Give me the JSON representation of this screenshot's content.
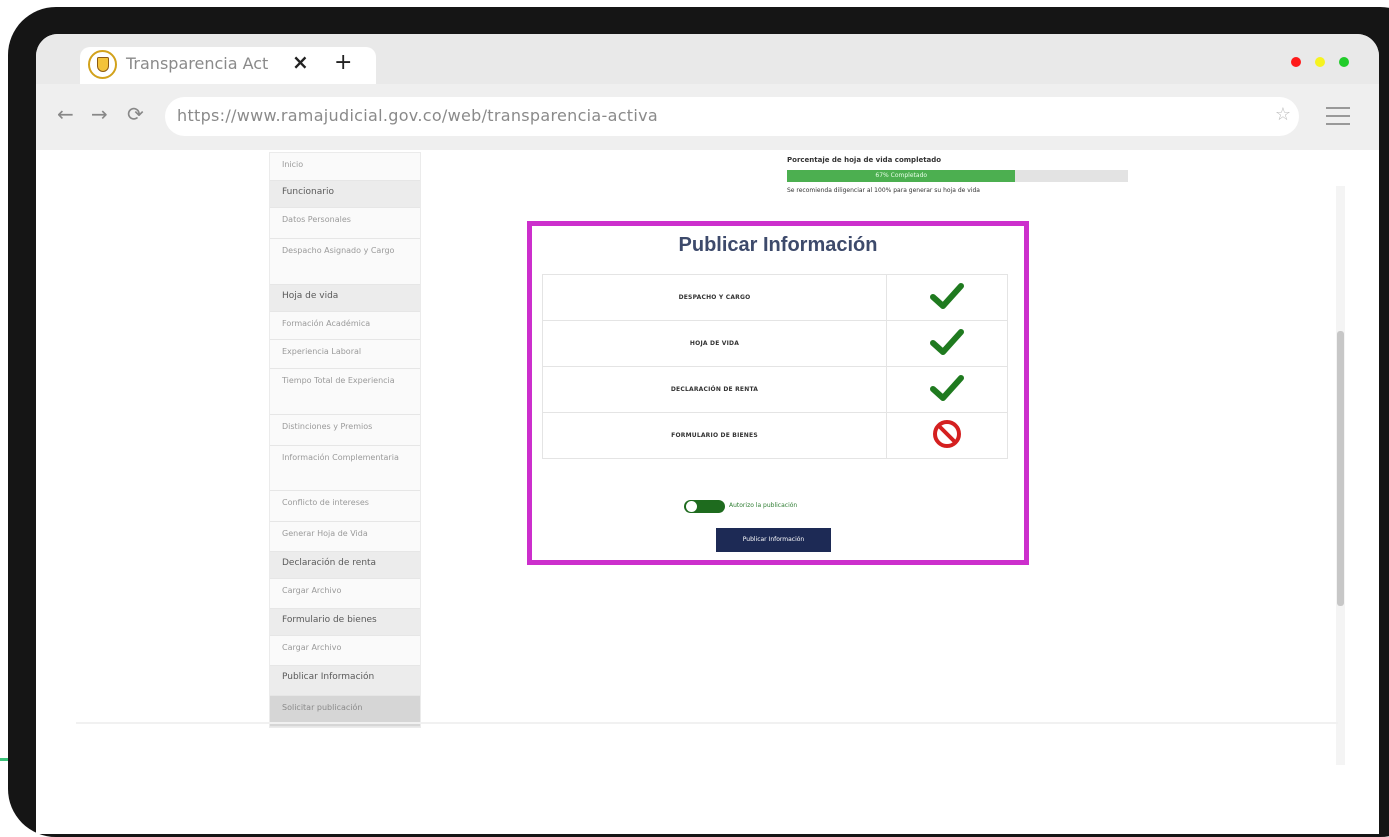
{
  "browser": {
    "tab_title": "Transparencia Act",
    "tab_close": "×",
    "new_tab": "+",
    "url": "https://www.ramajudicial.gov.co/web/transparencia-activa",
    "back": "←",
    "forward": "→",
    "reload": "⟳",
    "star": "☆",
    "window_dots": [
      "#ff1a1a",
      "#f6f320",
      "#21cc2a"
    ]
  },
  "sidebar": {
    "items": [
      {
        "label": "Inicio",
        "type": "item"
      },
      {
        "label": "Funcionario",
        "type": "head"
      },
      {
        "label": "Datos Personales",
        "type": "item"
      },
      {
        "label": "Despacho Asignado y Cargo",
        "type": "item"
      },
      {
        "label": "Hoja de vida",
        "type": "head"
      },
      {
        "label": "Formación Académica",
        "type": "item"
      },
      {
        "label": "Experiencia Laboral",
        "type": "item"
      },
      {
        "label": "Tiempo Total de Experiencia",
        "type": "item"
      },
      {
        "label": "Distinciones y Premios",
        "type": "item"
      },
      {
        "label": "Información Complementaria",
        "type": "item"
      },
      {
        "label": "Conflicto de intereses",
        "type": "item"
      },
      {
        "label": "Generar Hoja de Vida",
        "type": "item"
      },
      {
        "label": "Declaración de renta",
        "type": "head"
      },
      {
        "label": "Cargar Archivo",
        "type": "item"
      },
      {
        "label": "Formulario de bienes",
        "type": "head"
      },
      {
        "label": "Cargar Archivo",
        "type": "item"
      },
      {
        "label": "Publicar Información",
        "type": "head"
      },
      {
        "label": "Solicitar publicación",
        "type": "last"
      }
    ]
  },
  "progress": {
    "label": "Porcentaje de hoja de vida completado",
    "percent": 67,
    "fill_text": "67% Completado",
    "note": "Se recomienda diligenciar al 100% para generar su hoja de vida"
  },
  "publish": {
    "title": "Publicar Información",
    "rows": [
      {
        "label": "DESPACHO Y CARGO",
        "status": "check-icon"
      },
      {
        "label": "HOJA DE VIDA",
        "status": "check-icon"
      },
      {
        "label": "DECLARACIÓN DE RENTA",
        "status": "check-icon"
      },
      {
        "label": "FORMULARIO DE BIENES",
        "status": "ban-icon"
      }
    ],
    "toggle_label": "Autorizo la publicación",
    "button_label": "Publicar Información",
    "colors": {
      "check": "#1f7a1f",
      "ban": "#d42020",
      "highlight": "#cc2fcc"
    }
  }
}
